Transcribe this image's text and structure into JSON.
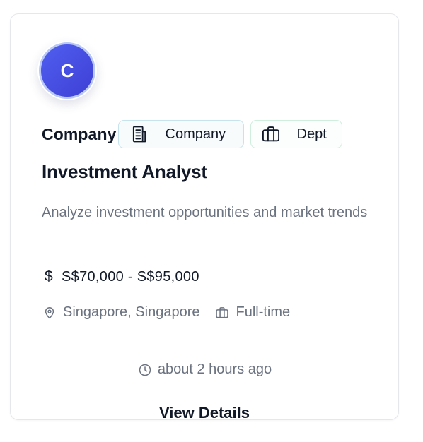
{
  "card": {
    "avatar_initial": "C",
    "company_name": "Company",
    "tags": {
      "company_label": "Company",
      "company_icon": "building-icon",
      "dept_label": "Dept",
      "dept_icon": "briefcase-icon"
    },
    "job_title": "Investment Analyst",
    "description": "Analyze investment opportunities and market trends",
    "salary": {
      "icon": "dollar-icon",
      "range": "S$70,000 - S$95,000"
    },
    "location": {
      "icon": "map-pin-icon",
      "text": "Singapore, Singapore"
    },
    "employment_type": {
      "icon": "briefcase-icon",
      "text": "Full-time"
    },
    "posted": {
      "icon": "clock-icon",
      "text": "about 2 hours ago"
    },
    "view_details_label": "View Details"
  },
  "colors": {
    "avatar_gradient_start": "#4f5ff0",
    "avatar_gradient_end": "#3f3fd4",
    "avatar_ring": "#b9c8f6",
    "text_primary": "#111827",
    "text_muted": "#6b7280",
    "company_tag_border": "#c7e3ec",
    "dept_tag_border": "#cfeedd"
  }
}
